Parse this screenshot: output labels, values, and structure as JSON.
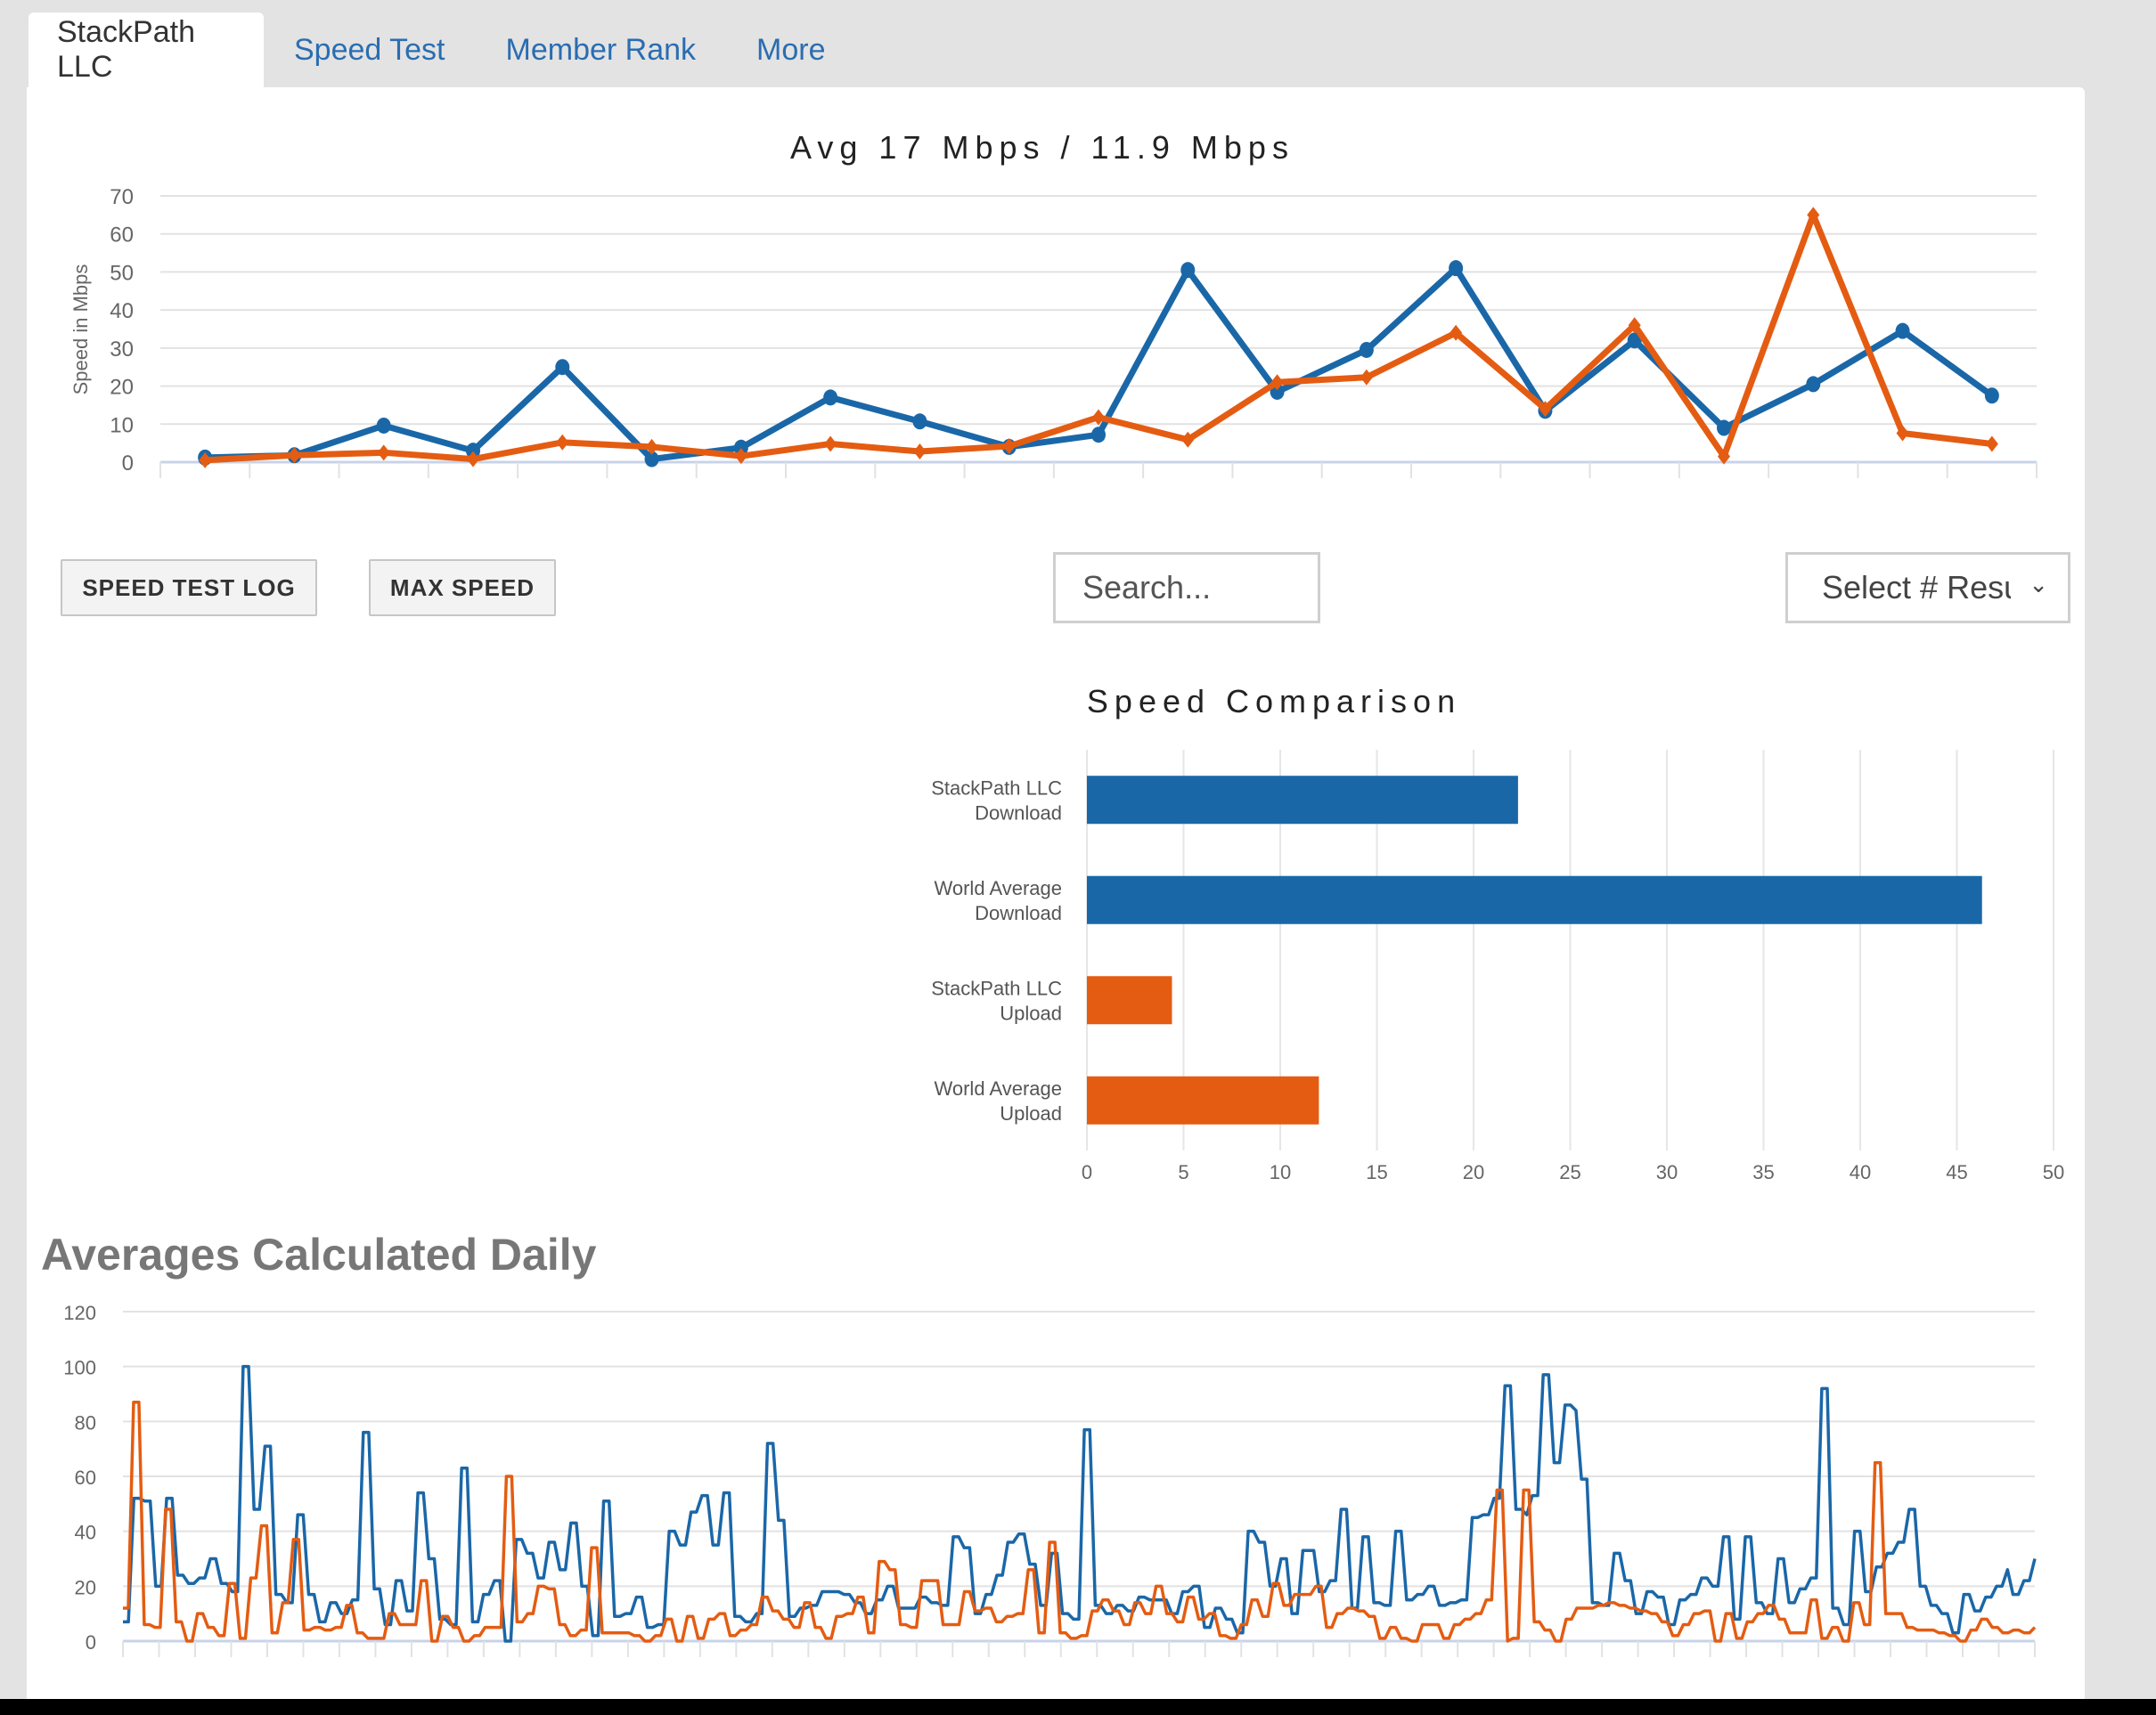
{
  "tabs": [
    {
      "label": "StackPath LLC",
      "active": true
    },
    {
      "label": "Speed Test",
      "active": false
    },
    {
      "label": "Member Rank",
      "active": false
    },
    {
      "label": "More",
      "active": false
    }
  ],
  "colors": {
    "download": "#1a67a8",
    "upload": "#e45c12",
    "link": "#2a6db1"
  },
  "toolbar": {
    "speed_test_log_label": "SPEED TEST LOG",
    "max_speed_label": "MAX SPEED",
    "search_placeholder": "Search...",
    "select_value": "Select # Results",
    "select_icon": "chevron-down-icon"
  },
  "section_heading": "Averages Calculated Daily",
  "chart_data": [
    {
      "type": "line",
      "title": "Avg 17 Mbps / 11.9 Mbps",
      "ylabel": "Speed in Mbps",
      "xlabel": "",
      "ylim": [
        0,
        70
      ],
      "yticks": [
        0,
        10,
        20,
        30,
        40,
        50,
        60,
        70
      ],
      "grid": true,
      "x": [
        1,
        2,
        3,
        4,
        5,
        6,
        7,
        8,
        9,
        10,
        11,
        12,
        13,
        14,
        15,
        16,
        17,
        18,
        19,
        20,
        21
      ],
      "series": [
        {
          "name": "Download",
          "marker": "circle",
          "values": [
            1.2,
            1.8,
            9.6,
            3.0,
            25.0,
            0.8,
            3.8,
            17.0,
            10.7,
            4.0,
            7.2,
            50.5,
            18.5,
            29.5,
            51.0,
            13.5,
            32.0,
            9.0,
            20.5,
            34.5,
            17.5
          ]
        },
        {
          "name": "Upload",
          "marker": "diamond",
          "values": [
            0.5,
            1.8,
            2.5,
            0.8,
            5.2,
            4.0,
            1.6,
            4.8,
            2.8,
            4.2,
            11.8,
            5.9,
            21.0,
            22.3,
            34.0,
            14.0,
            36.0,
            1.5,
            65.0,
            7.6,
            4.8
          ]
        }
      ]
    },
    {
      "type": "bar",
      "orientation": "horizontal",
      "title": "Speed Comparison",
      "categories": [
        "StackPath LLC\nDownload",
        "World Average\nDownload",
        "StackPath LLC\nUpload",
        "World Average\nUpload"
      ],
      "values": [
        22.3,
        46.3,
        4.4,
        12.0
      ],
      "bar_colors": [
        "#1a67a8",
        "#1a67a8",
        "#e45c12",
        "#e45c12"
      ],
      "xlim": [
        0,
        50
      ],
      "xticks": [
        0,
        5,
        10,
        15,
        20,
        25,
        30,
        35,
        40,
        45,
        50
      ],
      "grid": true
    },
    {
      "type": "line",
      "title": "Averages Calculated Daily",
      "ylim": [
        0,
        120
      ],
      "yticks": [
        0,
        20,
        40,
        60,
        80,
        100,
        120
      ],
      "grid": true,
      "series": [
        {
          "name": "Download",
          "values": [
            7,
            7,
            52,
            52,
            51,
            51,
            20,
            20,
            52,
            52,
            24,
            24,
            21,
            21,
            23,
            23,
            30,
            30,
            21,
            21,
            18,
            18,
            100,
            100,
            48,
            48,
            71,
            71,
            17,
            17,
            14,
            14,
            46,
            46,
            17,
            17,
            7,
            7,
            14,
            14,
            10,
            10,
            15,
            15,
            76,
            76,
            19,
            19,
            6,
            6,
            22,
            22,
            11,
            11,
            54,
            54,
            30,
            30,
            8,
            8,
            6,
            6,
            63,
            63,
            7,
            7,
            17,
            17,
            22,
            22,
            0,
            0,
            37,
            37,
            32,
            32,
            23,
            23,
            36,
            36,
            26,
            26,
            43,
            43,
            20,
            20,
            2,
            2,
            51,
            51,
            9,
            9,
            10,
            10,
            16,
            16,
            5,
            5,
            6,
            6,
            40,
            40,
            35,
            35,
            47,
            47,
            53,
            53,
            35,
            35,
            54,
            54,
            9,
            9,
            7,
            7,
            10,
            10,
            72,
            72,
            44,
            44,
            9,
            9,
            12,
            12,
            13,
            13,
            18,
            18,
            18,
            18,
            17,
            17,
            14,
            14,
            10,
            10,
            15,
            15,
            20,
            20,
            12,
            12,
            12,
            12,
            16,
            16,
            14,
            14,
            13,
            13,
            38,
            38,
            34,
            34,
            10,
            10,
            17,
            17,
            24,
            24,
            36,
            36,
            39,
            39,
            28,
            28,
            13,
            13,
            32,
            32,
            10,
            10,
            8,
            8,
            77,
            77,
            13,
            13,
            10,
            10,
            13,
            13,
            11,
            11,
            16,
            16,
            15,
            15,
            15,
            15,
            10,
            10,
            18,
            18,
            20,
            20,
            5,
            5,
            12,
            12,
            8,
            8,
            3,
            3,
            40,
            40,
            36,
            36,
            20,
            20,
            30,
            30,
            10,
            10,
            33,
            33,
            33,
            18,
            18,
            22,
            22,
            48,
            48,
            12,
            12,
            38,
            38,
            14,
            14,
            13,
            13,
            40,
            40,
            15,
            15,
            17,
            17,
            20,
            20,
            13,
            13,
            14,
            14,
            15,
            15,
            45,
            45,
            46,
            46,
            52,
            52,
            93,
            93,
            48,
            48,
            46,
            53,
            53,
            97,
            97,
            65,
            65,
            86,
            86,
            84,
            59,
            59,
            14,
            14,
            13,
            13,
            32,
            32,
            22,
            22,
            10,
            10,
            18,
            18,
            16,
            16,
            6,
            6,
            15,
            15,
            17,
            17,
            23,
            23,
            20,
            20,
            38,
            38,
            8,
            8,
            38,
            38,
            14,
            14,
            10,
            10,
            30,
            30,
            14,
            14,
            19,
            19,
            23,
            23,
            92,
            92,
            12,
            12,
            6,
            6,
            40,
            40,
            18,
            18,
            27,
            27,
            32,
            32,
            36,
            36,
            48,
            48,
            20,
            20,
            13,
            13,
            10,
            10,
            3,
            3,
            17,
            17,
            11,
            11,
            16,
            16,
            20,
            20,
            26,
            17,
            17,
            22,
            22,
            30
          ]
        },
        {
          "name": "Upload",
          "values": [
            12,
            12,
            87,
            87,
            6,
            6,
            5,
            5,
            48,
            48,
            7,
            7,
            0,
            0,
            10,
            10,
            5,
            5,
            2,
            2,
            21,
            21,
            1,
            1,
            23,
            23,
            42,
            42,
            3,
            3,
            14,
            14,
            37,
            37,
            4,
            4,
            5,
            5,
            4,
            4,
            5,
            5,
            13,
            13,
            3,
            3,
            1,
            1,
            1,
            1,
            10,
            10,
            6,
            6,
            6,
            6,
            22,
            22,
            0,
            0,
            9,
            9,
            5,
            5,
            0,
            0,
            2,
            2,
            5,
            5,
            5,
            5,
            60,
            60,
            7,
            7,
            10,
            10,
            20,
            20,
            19,
            19,
            6,
            6,
            2,
            2,
            4,
            4,
            34,
            34,
            3,
            3,
            3,
            3,
            3,
            3,
            2,
            2,
            0,
            0,
            2,
            2,
            8,
            8,
            0,
            0,
            9,
            9,
            1,
            1,
            8,
            8,
            10,
            10,
            2,
            2,
            4,
            4,
            6,
            6,
            16,
            16,
            11,
            11,
            8,
            8,
            5,
            5,
            14,
            14,
            5,
            5,
            1,
            1,
            9,
            9,
            10,
            10,
            16,
            16,
            3,
            3,
            29,
            29,
            26,
            26,
            6,
            6,
            5,
            5,
            22,
            22,
            22,
            22,
            6,
            6,
            6,
            6,
            18,
            18,
            11,
            11,
            12,
            12,
            7,
            7,
            9,
            9,
            10,
            10,
            26,
            26,
            3,
            3,
            36,
            36,
            3,
            3,
            1,
            1,
            2,
            2,
            11,
            11,
            15,
            15,
            11,
            11,
            6,
            6,
            14,
            14,
            10,
            10,
            20,
            20,
            10,
            10,
            7,
            7,
            16,
            16,
            8,
            8,
            10,
            10,
            2,
            2,
            1,
            1,
            6,
            6,
            15,
            15,
            9,
            9,
            21,
            21,
            13,
            13,
            17,
            17,
            17,
            17,
            20,
            20,
            5,
            5,
            10,
            10,
            12,
            12,
            11,
            11,
            9,
            9,
            1,
            1,
            5,
            5,
            1,
            1,
            0,
            0,
            6,
            6,
            6,
            6,
            1,
            1,
            6,
            6,
            8,
            8,
            10,
            10,
            15,
            15,
            55,
            55,
            0,
            1,
            1,
            55,
            55,
            7,
            7,
            4,
            4,
            0,
            0,
            8,
            8,
            12,
            12,
            12,
            12,
            13,
            13,
            14,
            14,
            13,
            13,
            12,
            12,
            11,
            11,
            10,
            10,
            7,
            7,
            2,
            2,
            6,
            6,
            10,
            10,
            11,
            11,
            0,
            0,
            10,
            10,
            1,
            1,
            7,
            7,
            10,
            10,
            13,
            13,
            8,
            8,
            3,
            3,
            3,
            3,
            15,
            15,
            1,
            1,
            5,
            5,
            0,
            0,
            14,
            14,
            6,
            6,
            65,
            65,
            10,
            10,
            10,
            10,
            5,
            5,
            4,
            4,
            4,
            4,
            3,
            3,
            2,
            2,
            0,
            0,
            4,
            4,
            8,
            8,
            5,
            5,
            3,
            3,
            4,
            4,
            3,
            3,
            5
          ]
        }
      ]
    }
  ]
}
